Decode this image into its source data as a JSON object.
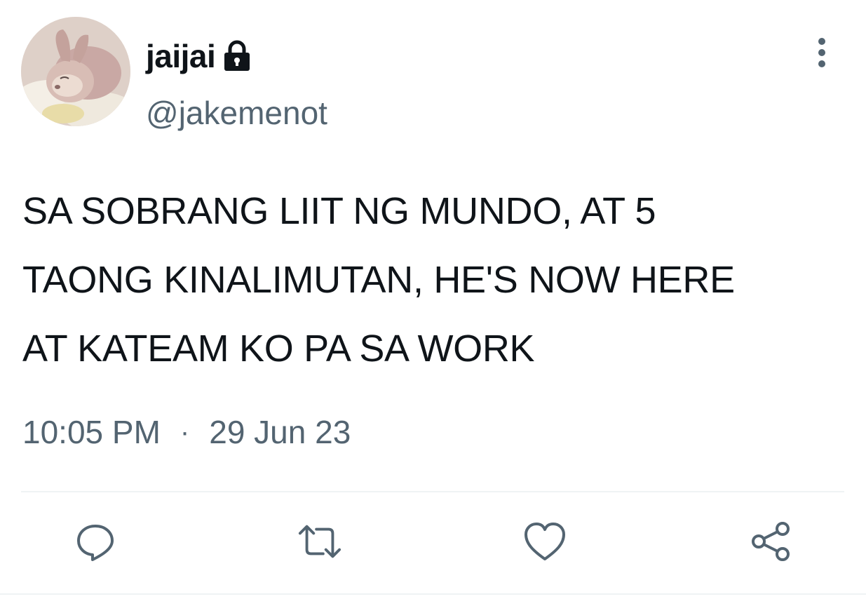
{
  "user": {
    "display_name": "jaijai",
    "handle": "@jakemenot",
    "protected": true,
    "avatar": "avatar-image"
  },
  "tweet": {
    "text": "SA SOBRANG LIIT NG MUNDO, AT 5\nTAONG KINALIMUTAN, HE'S NOW HERE\nAT KATEAM KO PA SA WORK",
    "time": "10:05 PM",
    "separator": "·",
    "date": "29 Jun 23"
  },
  "icons": {
    "lock": "lock-icon",
    "more": "more-vertical-icon",
    "reply": "reply-icon",
    "retweet": "retweet-icon",
    "like": "heart-icon",
    "share": "share-icon"
  },
  "colors": {
    "text": "#0f1419",
    "secondary": "#536471",
    "divider": "#eff3f4"
  }
}
